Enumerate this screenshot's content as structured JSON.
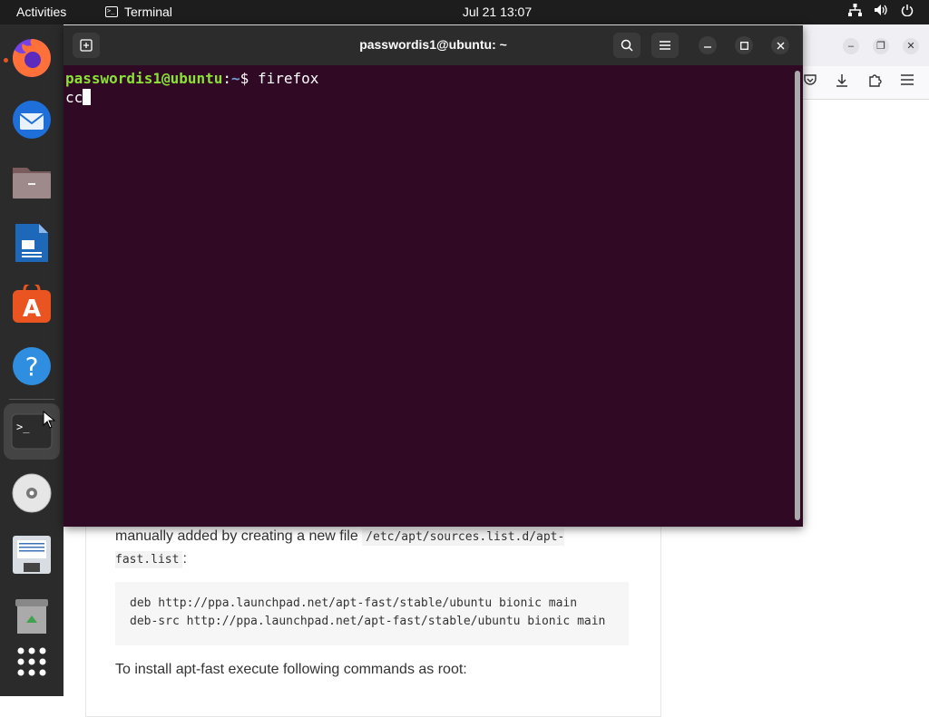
{
  "topbar": {
    "activities": "Activities",
    "app_name": "Terminal",
    "clock": "Jul 21  13:07",
    "icons": [
      "network-icon",
      "volume-icon",
      "power-icon"
    ]
  },
  "dock": {
    "items": [
      {
        "name": "firefox",
        "running": true
      },
      {
        "name": "thunderbird",
        "running": false
      },
      {
        "name": "files",
        "running": false
      },
      {
        "name": "libreoffice-writer",
        "running": false
      },
      {
        "name": "ubuntu-software",
        "running": false
      },
      {
        "name": "help",
        "running": false
      },
      {
        "name": "terminal",
        "running": true,
        "active": true
      },
      {
        "name": "dvd-drive",
        "running": false
      },
      {
        "name": "text-document",
        "running": false
      },
      {
        "name": "trash",
        "running": false
      },
      {
        "name": "show-applications",
        "running": false
      }
    ],
    "terminal_glyph": ">_"
  },
  "terminal": {
    "title": "passwordis1@ubuntu: ~",
    "prompt_user": "passwordis1@ubuntu",
    "prompt_sep": ":",
    "prompt_path": "~",
    "prompt_dollar": "$ ",
    "command": "firefox",
    "typed_line": "cc",
    "colors": {
      "background": "#300a24",
      "user": "#8ae234",
      "path": "#729fcf"
    }
  },
  "webpage": {
    "para_start": "manually added by creating a new file ",
    "inline_code": "/etc/apt/sources.list.d/apt-fast.list",
    "para_end": ":",
    "code_block": "deb http://ppa.launchpad.net/apt-fast/stable/ubuntu bionic main\ndeb-src http://ppa.launchpad.net/apt-fast/stable/ubuntu bionic main",
    "para2": "To install apt-fast execute following commands as root:"
  }
}
